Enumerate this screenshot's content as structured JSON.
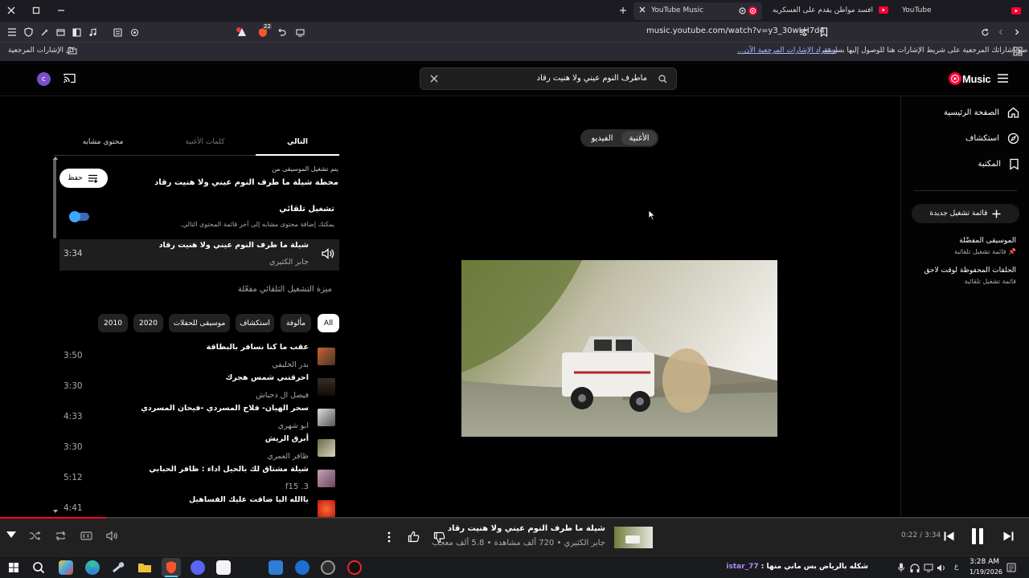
{
  "browser": {
    "tabs": [
      {
        "label": "YouTube Music",
        "active": true
      },
      {
        "label": "افسد مواطن يقدم على العسكريه -",
        "active": false
      },
      {
        "label": "YouTube",
        "active": false
      }
    ],
    "url": "music.youtube.com/watch?v=y3_30wLH7d4",
    "shield_badge": "22",
    "bookmarks_all": "كل الإشارات المرجعية",
    "bookmarks_hint": "ضع إشاراتك المرجعية على شريط الإشارات هنا للوصول إليها بسرعة.",
    "bookmarks_import": "إستيراد الإشارات المرجعية الآن..."
  },
  "header": {
    "logo": "Music",
    "search_value": "ماطرف النوم عيني ولا هنيت رقاد",
    "avatar_letter": "c"
  },
  "nav": {
    "items": [
      {
        "label": "الصفحة الرئيسية",
        "icon": "home-icon"
      },
      {
        "label": "استكشاف",
        "icon": "compass-icon"
      },
      {
        "label": "المكتبة",
        "icon": "library-icon"
      }
    ],
    "new_playlist": "قائمة تشغيل جديدة",
    "playlists": [
      {
        "name": "الموسيقى المفضّلة",
        "sub": "قائمة تشغيل تلقائية"
      },
      {
        "name": "الحلقات المحفوظة لوقت لاحق",
        "sub": "قائمة تشغيل تلقائية"
      }
    ]
  },
  "player": {
    "toggle_song": "الأغنية",
    "toggle_video": "الفيديو"
  },
  "queue": {
    "tabs": [
      "التالي",
      "كلمات الأغنية",
      "محتوى مشابه"
    ],
    "playing_from_label": "يتم تشغيل الموسيقى من",
    "playing_from": "محطة شيلة ما طرف النوم عيني ولا هنيت رقاد",
    "save_label": "حفظ",
    "autoplay_title": "تشغيل تلقائي",
    "autoplay_desc": "يمكنك إضافة محتوى مشابه إلى آخر قائمة المحتوى التالي.",
    "current": {
      "title": "شيلة ما طرف النوم عيني ولا هنيت رقاد",
      "artist": "جابر الكثيري",
      "duration": "3:34"
    },
    "autoplay_enabled": "ميزة التشغيل التلقائي مفعّلة",
    "chips": [
      "All",
      "مألوفة",
      "استكشاف",
      "موسيقى للحفلات",
      "2020",
      "2010"
    ],
    "items": [
      {
        "title": "عقب ما كنا نسافر بالبطاقة",
        "artist": "بدر الخليفي",
        "duration": "3:50"
      },
      {
        "title": "احرقتني شمس هجرك",
        "artist": "فيصل ال دحباش",
        "duration": "3:30"
      },
      {
        "title": "سحر الهيان- فلاح المسردي -فيحان المسردي",
        "artist": "ابو شهري",
        "duration": "4:33"
      },
      {
        "title": "أبرق الريش",
        "artist": "ظافر العمري",
        "duration": "3:30"
      },
      {
        "title": "شيلة مشتاق لك بالحيل اداء : ظافر الحبابي",
        "artist": "3. f15",
        "duration": "5:12"
      },
      {
        "title": "ياالله اليا ضاقت عليك الفساهيل",
        "artist": "",
        "duration": "4:41"
      }
    ]
  },
  "playerbar": {
    "time": "0:22 / 3:34",
    "progress": 0.103,
    "title": "شيلة ما طرف النوم عيني ولا هنيت رقاد",
    "meta": "جابر الكثيري • 720 ألف مشاهدة • 5.8 ألف معجب"
  },
  "taskbar": {
    "ticker": "شكله بالرياض بس ماني منها :",
    "ticker_user": "istar_77",
    "time": "3:28 AM",
    "date": "1/19/2026",
    "lang": "ع"
  }
}
